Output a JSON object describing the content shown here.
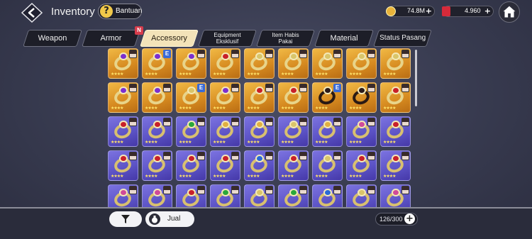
{
  "header": {
    "title": "Inventory",
    "help_label": "Bantuan",
    "help_glyph": "?",
    "gold_amount": "74.8M",
    "ticket_amount": "4.960",
    "plus_glyph": "+"
  },
  "tabs": [
    {
      "label": "Weapon",
      "active": false
    },
    {
      "label": "Armor",
      "active": false,
      "badge": "N"
    },
    {
      "label": "Accessory",
      "active": true
    },
    {
      "label": "Equipment Eksklusif",
      "active": false
    },
    {
      "label": "Item Habis Pakai",
      "active": false
    },
    {
      "label": "Material",
      "active": false
    },
    {
      "label": "Status Pasang",
      "active": false
    }
  ],
  "grid": {
    "columns": 9,
    "rows": [
      [
        "gold-purplegem-portrait",
        "gold-purplegem-etag",
        "gold-purplegem-portrait",
        "gold-red-portrait",
        "gold-plain-portrait",
        "gold-plain-portrait",
        "gold-plain-portrait",
        "gold-plain-portrait",
        "gold-plain-portrait"
      ],
      [
        "gold-purplegem-portrait",
        "gold-purplegem-portrait",
        "gold-plain-etag",
        "gold-purplegem-portrait",
        "gold-red-portrait",
        "gold-red-portrait",
        "gold-dark-etag",
        "gold-dark-portrait",
        "gold-red-portrait"
      ],
      [
        "purple-red-portrait",
        "purple-red-portrait",
        "purple-green-portrait",
        "purple-gold-portrait",
        "purple-gold-portrait",
        "purple-plain-portrait",
        "purple-gold-portrait",
        "purple-pink-portrait",
        "purple-red-portrait"
      ],
      [
        "purple-red-portrait",
        "purple-red-portrait",
        "purple-red-portrait",
        "purple-red-portrait",
        "purple-blue-portrait",
        "purple-red-portrait",
        "purple-plain-portrait",
        "purple-red-portrait",
        "purple-red-portrait"
      ],
      [
        "purple-pink-portrait",
        "purple-pink-portrait",
        "purple-red-portrait",
        "purple-green-portrait",
        "purple-plain-portrait",
        "purple-green-portrait",
        "purple-blue-portrait",
        "purple-plain-portrait",
        "purple-pink-portrait"
      ]
    ],
    "etag_label": "E",
    "stars": "★★★★"
  },
  "bottom": {
    "sell_label": "Jual",
    "capacity": "126/300",
    "plus_glyph": "+"
  },
  "colors": {
    "gold_cell": "#e0a030",
    "purple_cell": "#5b52c4",
    "active_tab": "#f3e3b9",
    "badge": "#d63b4b"
  }
}
